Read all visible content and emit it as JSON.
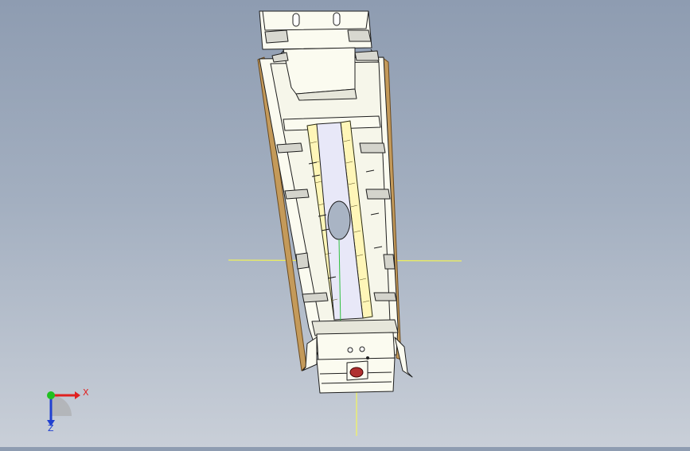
{
  "viewport": {
    "background_top": "#8e9cb1",
    "background_bottom": "#c9cfd8"
  },
  "triad": {
    "x_label": "X",
    "z_label": "Z",
    "x_color": "#e02020",
    "y_color": "#20c020",
    "z_color": "#2040d0"
  },
  "model": {
    "body_color": "#fbfbf0",
    "edge_color": "#1e1e1e",
    "shadow_color": "#b8894e",
    "slot_color": "#e8e8f8",
    "origin_line_color": "#ffff40",
    "icons": [
      "origin-crosshair",
      "coordinate-triad"
    ]
  }
}
